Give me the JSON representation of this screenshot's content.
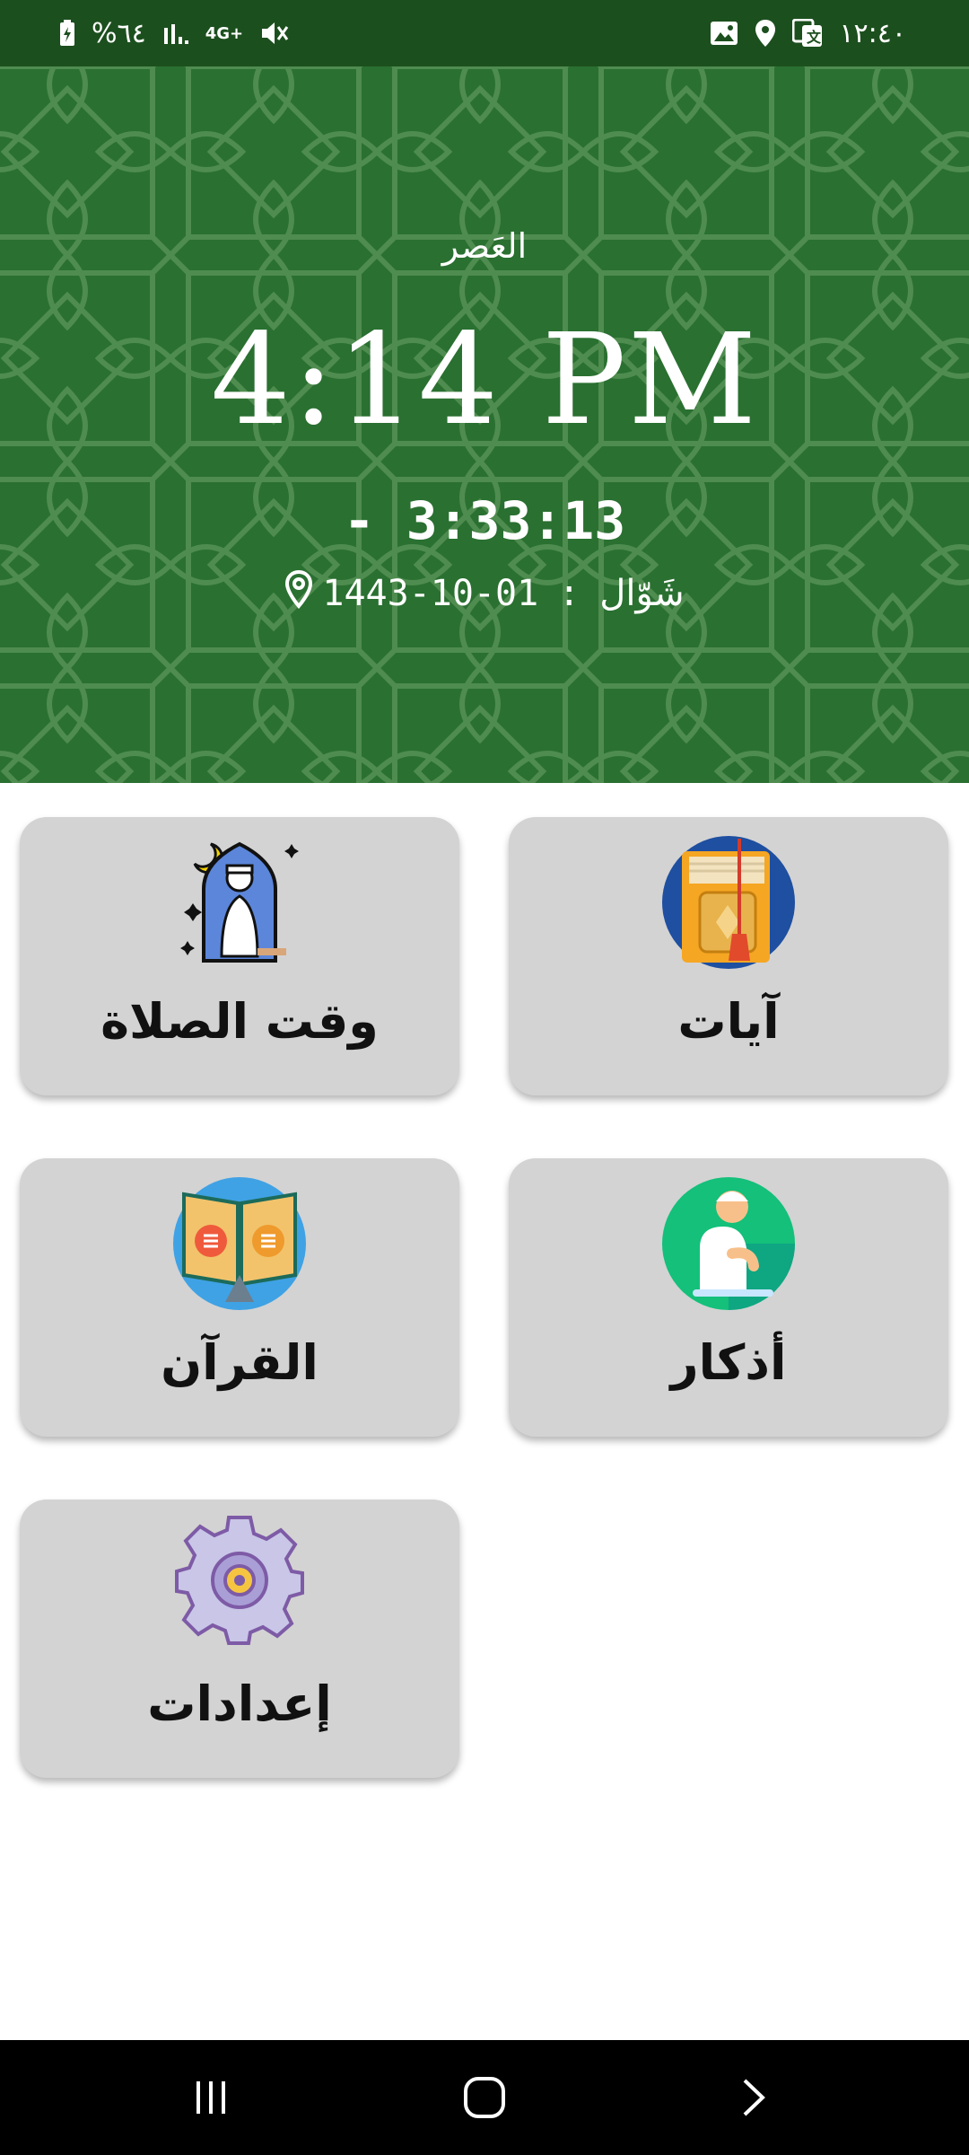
{
  "status_bar": {
    "battery": "%٦٤",
    "network": "4G+",
    "time": "١٢:٤٠"
  },
  "header": {
    "prayer_name": "العَصر",
    "prayer_time": "4:14 PM",
    "countdown": "- 3:33:13",
    "hijri_date": "1443-10-01",
    "separator": ":",
    "hijri_month": "شَوّال"
  },
  "menu": {
    "prayer_times": "وقت الصلاة",
    "ayat": "آيات",
    "quran": "القرآن",
    "adhkar": "أذكار",
    "settings": "إعدادات"
  },
  "icons": {
    "prayer_times": "mosque-prayer-icon",
    "ayat": "book-with-tassel-icon",
    "quran": "open-quran-icon",
    "adhkar": "praying-person-icon",
    "settings": "gear-icon"
  },
  "colors": {
    "header_green": "#2a7031",
    "status_green": "#1c4f1e",
    "card_grey": "#d3d3d3"
  }
}
